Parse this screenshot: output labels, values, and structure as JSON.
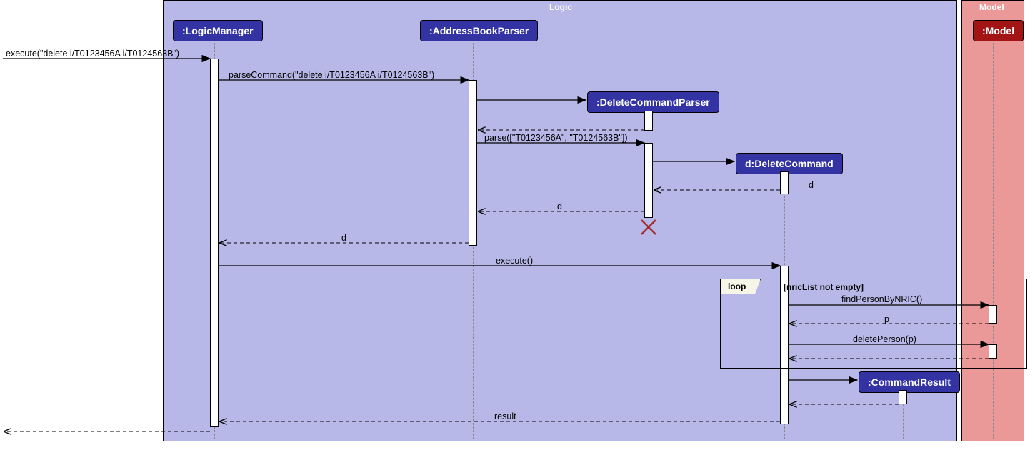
{
  "containers": {
    "logic": {
      "label": "Logic",
      "color": "#b8b8e8"
    },
    "model": {
      "label": "Model",
      "color": "#eb9898"
    }
  },
  "participants": {
    "logicManager": ":LogicManager",
    "addressBookParser": ":AddressBookParser",
    "deleteCommandParser": ":DeleteCommandParser",
    "deleteCommand": "d:DeleteCommand",
    "commandResult": ":CommandResult",
    "model": ":Model"
  },
  "messages": {
    "execute": "execute(\"delete i/T0123456A i/T0124563B\")",
    "parseCommand": "parseCommand(\"delete i/T0123456A i/T0124563B\")",
    "parse": "parse([\"T0123456A\", \"T0124563B\"])",
    "returnD1": "d",
    "returnD2": "d",
    "returnD3": "d",
    "execute2": "execute()",
    "findPerson": "findPersonByNRIC()",
    "returnP": "p",
    "deletePerson": "deletePerson(p)",
    "result": "result"
  },
  "loop": {
    "label": "loop",
    "condition": "[nricList not empty]"
  }
}
